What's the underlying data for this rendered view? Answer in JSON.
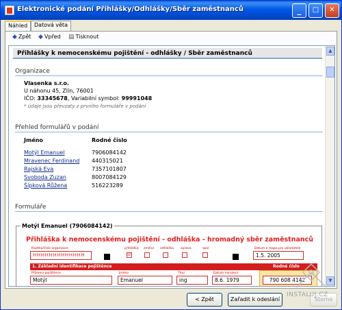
{
  "window": {
    "title": "Elektronické podání Přihlášky/Odhlášky/Sběr zaměstnanců",
    "buttons": {
      "minimize": "_",
      "maximize": "□",
      "close": "✕"
    }
  },
  "tabs": [
    {
      "label": "Náhled",
      "active": true
    },
    {
      "label": "Datová věta",
      "active": false
    }
  ],
  "toolbar": {
    "back": "Zpět",
    "forward": "Vpřed",
    "print": "Tisknout"
  },
  "document": {
    "header": "Přihlášky k nemocenskému pojištění - odhlášky / Sběr zaměstnanců",
    "organization": {
      "section_title": "Organizace",
      "name": "Vlasenka s.r.o.",
      "address": "U náhonu 45, Zlín, 76001",
      "ico_label": "IČO:",
      "ico": "33345678",
      "varsym_label": ", Variabilní symbol:",
      "varsym": "99991048",
      "note": "* údaje jsou převzaty z prvního formuláře v podání"
    },
    "overview": {
      "section_title": "Přehled formulářů v podání",
      "col_name": "Jméno",
      "col_birth": "Rodné číslo",
      "rows": [
        {
          "name": "Motýl Emanuel",
          "birth": "7906084142"
        },
        {
          "name": "Mravenec Ferdinand",
          "birth": "440315021"
        },
        {
          "name": "Rajská Eva",
          "birth": "7357101807"
        },
        {
          "name": "Svoboda Zuzan",
          "birth": "8007084129"
        },
        {
          "name": "Šípková Růžena",
          "birth": "516223289"
        }
      ]
    },
    "forms": {
      "section_title": "Formuláře",
      "box_title": "Motýl Emanuel (7906084142)",
      "form_title": "Přihláška k nemocenskému pojištění - odhláška - hromadný sběr zaměstnanců",
      "labels": {
        "top_left": "Razítko/číslo organizace",
        "prihlaska": "přihláška",
        "zmena": "změna",
        "odhlaska": "odhláška",
        "oprava": "oprava",
        "spor": "spor",
        "date_label": "Datum a mapa pro ukladatele",
        "band": "1. Základní identifikace pojištěnce",
        "band_right": "Rodné číslo",
        "f_surname": "Příjmení pojištěnce",
        "f_name": "Jméno",
        "f_title": "Titul",
        "f_birthdate": "Datum narození"
      },
      "values": {
        "org_code": "HHHHHHHHHHHHH",
        "date": "1.5. 2005",
        "surname": "Motýl",
        "name": "Emanuel",
        "title": "ing",
        "birthdate": "8.6. 1979",
        "birthnumber": "790 608 4142"
      }
    }
  },
  "buttons": {
    "back": "< Zpět",
    "submit": "Zařadit k odeslání",
    "cancel": "Storno"
  },
  "watermark": "INSTALUJ.CZ"
}
